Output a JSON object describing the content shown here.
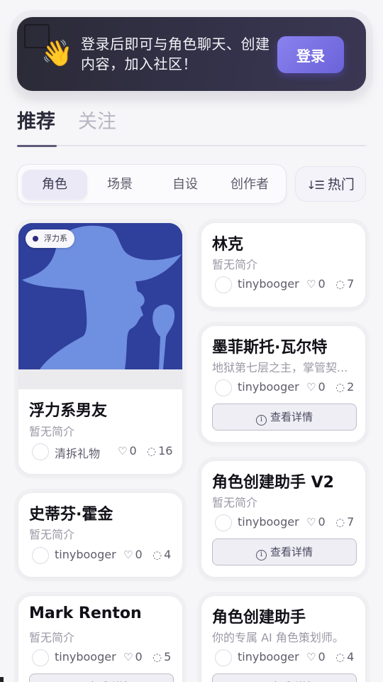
{
  "banner": {
    "message": "登录后即可与角色聊天、创建内容，加入社区！",
    "login_label": "登录",
    "emoji": "👋"
  },
  "tabs": {
    "active": "推荐",
    "inactive": "关注"
  },
  "filters": {
    "options": [
      "角色",
      "场景",
      "自设",
      "创作者"
    ],
    "selected": "角色"
  },
  "sort": {
    "label": "热门",
    "icon": "sort-descending-icon"
  },
  "detail_label": "查看详情",
  "cards": {
    "c1": {
      "badge": "浮力系",
      "title": "浮力系男友",
      "desc": "暂无简介",
      "author": "清拆礼物",
      "likes": "0",
      "comments": "16"
    },
    "c2": {
      "title": "林克",
      "desc": "暂无简介",
      "author": "tinybooger",
      "likes": "0",
      "comments": "7"
    },
    "c3": {
      "title": "墨菲斯托·瓦尔特",
      "desc": "地狱第七层之主，掌管契...",
      "author": "tinybooger",
      "likes": "0",
      "comments": "2"
    },
    "c4": {
      "title": "史蒂芬·霍金",
      "desc": "暂无简介",
      "author": "tinybooger",
      "likes": "0",
      "comments": "4"
    },
    "c5": {
      "title": "角色创建助手 V2",
      "desc": "暂无简介",
      "author": "tinybooger",
      "likes": "0",
      "comments": "7"
    },
    "c6": {
      "title": "Mark Renton",
      "desc": "暂无简介",
      "author": "tinybooger",
      "likes": "0",
      "comments": "5"
    },
    "c7": {
      "title": "角色创建助手",
      "desc": "你的专属 AI 角色策划师。",
      "author": "tinybooger",
      "likes": "0",
      "comments": "4"
    }
  },
  "colors": {
    "accent": "#6a62d8",
    "banner_bg": "#2b2a36",
    "hero_bg": "#2f3f9c"
  }
}
